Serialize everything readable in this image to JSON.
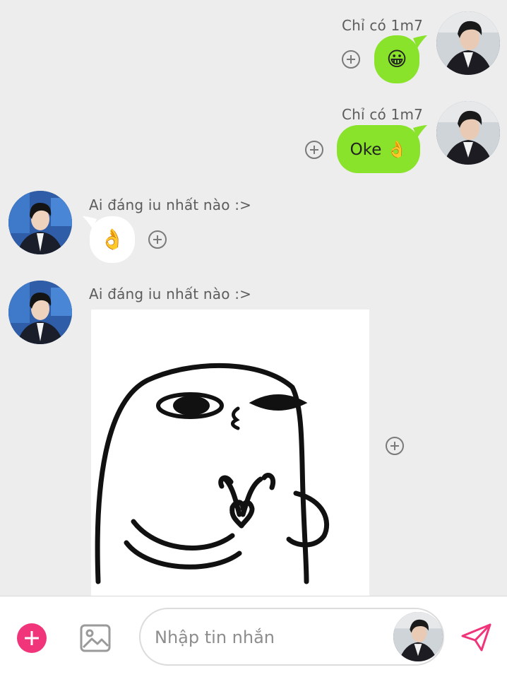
{
  "messages": [
    {
      "sender": "Chỉ có 1m7",
      "side": "me",
      "text": "😀",
      "kind": "emoji"
    },
    {
      "sender": "Chỉ có 1m7",
      "side": "me",
      "text": "Oke 👌",
      "kind": "text"
    },
    {
      "sender": "Ai đáng iu nhất nào :>",
      "side": "them",
      "text": "👌",
      "kind": "emoji"
    },
    {
      "sender": "Ai đáng iu nhất nào :>",
      "side": "them",
      "text": "",
      "kind": "sticker"
    }
  ],
  "composer": {
    "placeholder": "Nhập tin nhắn",
    "value": ""
  },
  "colors": {
    "my_bubble": "#88e32a",
    "their_bubble": "#ffffff",
    "accent": "#f0357a",
    "send_icon": "#f0357a",
    "background": "#ededed"
  },
  "icons": {
    "add": "plus-circle-icon",
    "image": "image-icon",
    "send": "paper-plane-icon",
    "reaction": "add-reaction-icon"
  }
}
